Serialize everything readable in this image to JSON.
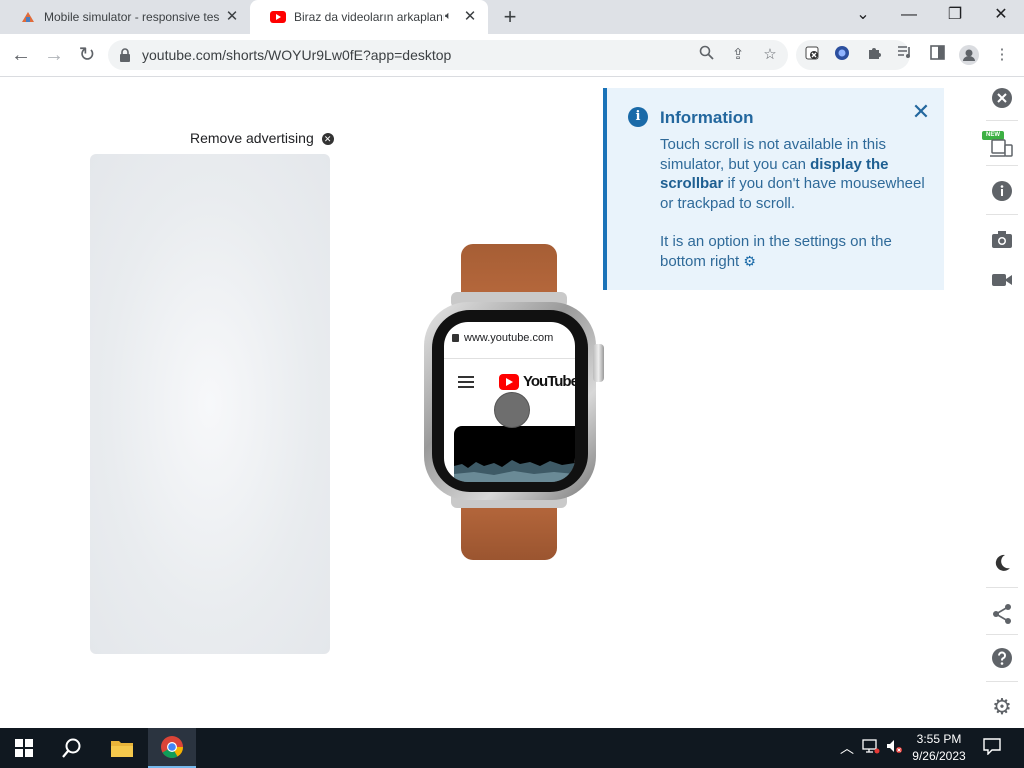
{
  "browser": {
    "tabs": [
      {
        "title": "Mobile simulator - responsive testing",
        "active": false
      },
      {
        "title": "Biraz da videoların arkaplanı",
        "active": true,
        "audio": true
      }
    ],
    "url": "youtube.com/shorts/WOYUr9Lw0fE?app=desktop"
  },
  "page": {
    "remove_ad_label": "Remove advertising",
    "watch": {
      "url": "www.youtube.com",
      "logo_text": "YouTube"
    },
    "info": {
      "title": "Information",
      "body_part1": "Touch scroll is not available in this simulator, but you can ",
      "body_bold": "display the scrollbar",
      "body_part2": " if you don't have mousewheel or trackpad to scroll.",
      "body2": "It is an option in the settings on the bottom right"
    },
    "sidebar": {
      "new_badge": "NEW"
    }
  },
  "taskbar": {
    "time": "3:55 PM",
    "date": "9/26/2023"
  },
  "colors": {
    "info_bg": "#e9f3fb",
    "info_accent": "#1a73b8",
    "band": "#b8693d",
    "taskbar": "#101820"
  }
}
